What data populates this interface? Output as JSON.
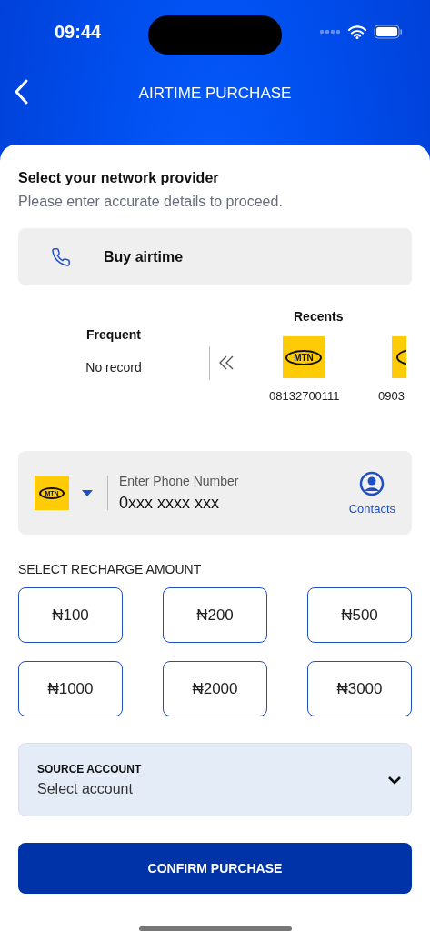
{
  "status_bar": {
    "time": "09:44"
  },
  "header": {
    "title": "AIRTIME PURCHASE"
  },
  "intro": {
    "title": "Select your network provider",
    "subtitle": "Please enter accurate details to proceed."
  },
  "service_tab": {
    "label": "Buy airtime"
  },
  "frequent": {
    "title": "Frequent",
    "empty_text": "No record"
  },
  "recents": {
    "title": "Recents",
    "items": [
      {
        "logo_text": "MTN",
        "number": "08132700111"
      },
      {
        "number": "0903"
      }
    ]
  },
  "phone_input": {
    "network_logo_text": "MTN",
    "label": "Enter Phone Number",
    "placeholder": "0xxx xxxx xxx",
    "contacts_label": "Contacts"
  },
  "amounts": {
    "title": "SELECT RECHARGE AMOUNT",
    "options": [
      {
        "label": "₦100",
        "selected": false
      },
      {
        "label": "₦200",
        "selected": false
      },
      {
        "label": "₦500",
        "selected": false
      },
      {
        "label": "₦1000",
        "selected": false
      },
      {
        "label": "₦2000",
        "selected": false
      },
      {
        "label": "₦3000",
        "selected": false
      }
    ]
  },
  "source_account": {
    "label": "SOURCE ACCOUNT",
    "placeholder": "Select account"
  },
  "confirm_button": {
    "label": "CONFIRM PURCHASE"
  }
}
